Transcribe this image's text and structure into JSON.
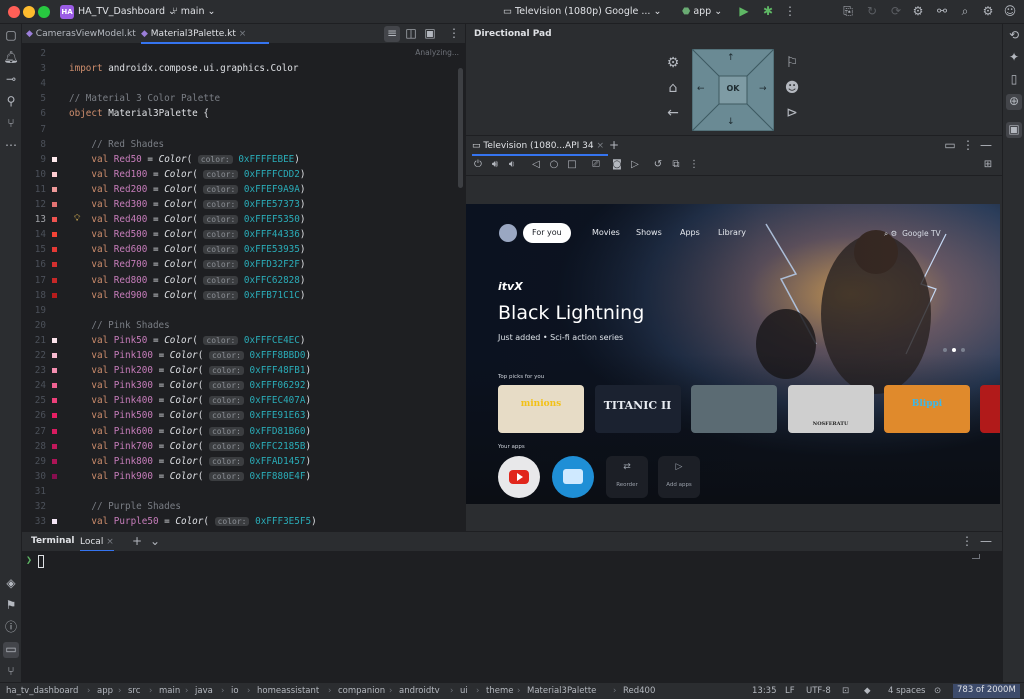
{
  "window": {
    "project": "HA_TV_Dashboard",
    "branch": "main",
    "device": "Television (1080p) Google ...",
    "run_config": "app"
  },
  "editor": {
    "tabs": [
      {
        "label": "CamerasViewModel.kt"
      },
      {
        "label": "Material3Palette.kt"
      }
    ],
    "analyzing": "Analyzing...",
    "lines": [
      {
        "n": "2",
        "html": ""
      },
      {
        "n": "3",
        "html": "<span class='kw'>import</span> androidx.compose.ui.graphics.Color"
      },
      {
        "n": "4",
        "html": ""
      },
      {
        "n": "5",
        "html": "<span class='cm'>// Material 3 Color Palette</span>"
      },
      {
        "n": "6",
        "html": "<span class='kw'>object</span> Material3Palette {"
      },
      {
        "n": "7",
        "html": ""
      },
      {
        "n": "8",
        "html": "    <span class='cm'>// Red Shades</span>"
      },
      {
        "n": "9",
        "sw": "#ffebee",
        "html": "    <span class='kw'>val</span> <span class='pr'>Red50</span> = <span class='fn'>Color</span>( <span class='hint'>color:</span> <span class='hx'>0xFFFFEBEE</span>)"
      },
      {
        "n": "10",
        "sw": "#ffcdd2",
        "html": "    <span class='kw'>val</span> <span class='pr'>Red100</span> = <span class='fn'>Color</span>( <span class='hint'>color:</span> <span class='hx'>0xFFFFCDD2</span>)"
      },
      {
        "n": "11",
        "sw": "#ef9a9a",
        "html": "    <span class='kw'>val</span> <span class='pr'>Red200</span> = <span class='fn'>Color</span>( <span class='hint'>color:</span> <span class='hx'>0xFFEF9A9A</span>)"
      },
      {
        "n": "12",
        "sw": "#e57373",
        "html": "    <span class='kw'>val</span> <span class='pr'>Red300</span> = <span class='fn'>Color</span>( <span class='hint'>color:</span> <span class='hx'>0xFFE57373</span>)"
      },
      {
        "n": "13",
        "sw": "#ef5350",
        "bulb": true,
        "html": "    <span class='kw'>val</span> <span class='pr'>Red400</span> = <span class='fn'>Color</span>( <span class='hint'>color:</span> <span class='hx'>0xFFEF5350</span>)"
      },
      {
        "n": "14",
        "sw": "#f44336",
        "html": "    <span class='kw'>val</span> <span class='pr'>Red500</span> = <span class='fn'>Color</span>( <span class='hint'>color:</span> <span class='hx'>0xFFF44336</span>)"
      },
      {
        "n": "15",
        "sw": "#e53935",
        "html": "    <span class='kw'>val</span> <span class='pr'>Red600</span> = <span class='fn'>Color</span>( <span class='hint'>color:</span> <span class='hx'>0xFFE53935</span>)"
      },
      {
        "n": "16",
        "sw": "#d32f2f",
        "html": "    <span class='kw'>val</span> <span class='pr'>Red700</span> = <span class='fn'>Color</span>( <span class='hint'>color:</span> <span class='hx'>0xFFD32F2F</span>)"
      },
      {
        "n": "17",
        "sw": "#c62828",
        "html": "    <span class='kw'>val</span> <span class='pr'>Red800</span> = <span class='fn'>Color</span>( <span class='hint'>color:</span> <span class='hx'>0xFFC62828</span>)"
      },
      {
        "n": "18",
        "sw": "#b71c1c",
        "html": "    <span class='kw'>val</span> <span class='pr'>Red900</span> = <span class='fn'>Color</span>( <span class='hint'>color:</span> <span class='hx'>0xFFB71C1C</span>)"
      },
      {
        "n": "19",
        "html": ""
      },
      {
        "n": "20",
        "html": "    <span class='cm'>// Pink Shades</span>"
      },
      {
        "n": "21",
        "sw": "#fce4ec",
        "html": "    <span class='kw'>val</span> <span class='pr'>Pink50</span> = <span class='fn'>Color</span>( <span class='hint'>color:</span> <span class='hx'>0xFFFCE4EC</span>)"
      },
      {
        "n": "22",
        "sw": "#f8bbd0",
        "html": "    <span class='kw'>val</span> <span class='pr'>Pink100</span> = <span class='fn'>Color</span>( <span class='hint'>color:</span> <span class='hx'>0xFFF8BBD0</span>)"
      },
      {
        "n": "23",
        "sw": "#f48fb1",
        "html": "    <span class='kw'>val</span> <span class='pr'>Pink200</span> = <span class='fn'>Color</span>( <span class='hint'>color:</span> <span class='hx'>0xFFF48FB1</span>)"
      },
      {
        "n": "24",
        "sw": "#f06292",
        "html": "    <span class='kw'>val</span> <span class='pr'>Pink300</span> = <span class='fn'>Color</span>( <span class='hint'>color:</span> <span class='hx'>0xFFF06292</span>)"
      },
      {
        "n": "25",
        "sw": "#ec407a",
        "html": "    <span class='kw'>val</span> <span class='pr'>Pink400</span> = <span class='fn'>Color</span>( <span class='hint'>color:</span> <span class='hx'>0xFFEC407A</span>)"
      },
      {
        "n": "26",
        "sw": "#e91e63",
        "html": "    <span class='kw'>val</span> <span class='pr'>Pink500</span> = <span class='fn'>Color</span>( <span class='hint'>color:</span> <span class='hx'>0xFFE91E63</span>)"
      },
      {
        "n": "27",
        "sw": "#d81b60",
        "html": "    <span class='kw'>val</span> <span class='pr'>Pink600</span> = <span class='fn'>Color</span>( <span class='hint'>color:</span> <span class='hx'>0xFFD81B60</span>)"
      },
      {
        "n": "28",
        "sw": "#c2185b",
        "html": "    <span class='kw'>val</span> <span class='pr'>Pink700</span> = <span class='fn'>Color</span>( <span class='hint'>color:</span> <span class='hx'>0xFFC2185B</span>)"
      },
      {
        "n": "29",
        "sw": "#ad1457",
        "html": "    <span class='kw'>val</span> <span class='pr'>Pink800</span> = <span class='fn'>Color</span>( <span class='hint'>color:</span> <span class='hx'>0xFFAD1457</span>)"
      },
      {
        "n": "30",
        "sw": "#880e4f",
        "html": "    <span class='kw'>val</span> <span class='pr'>Pink900</span> = <span class='fn'>Color</span>( <span class='hint'>color:</span> <span class='hx'>0xFF880E4F</span>)"
      },
      {
        "n": "31",
        "html": ""
      },
      {
        "n": "32",
        "html": "    <span class='cm'>// Purple Shades</span>"
      },
      {
        "n": "33",
        "sw": "#f3e5f5",
        "html": "    <span class='kw'>val</span> <span class='pr'>Purple50</span> = <span class='fn'>Color</span>( <span class='hint'>color:</span> <span class='hx'>0xFFF3E5F5</span>)"
      }
    ]
  },
  "dpad": {
    "title": "Directional Pad",
    "ok": "OK",
    "up": "↑",
    "down": "↓",
    "left": "←",
    "right": "→"
  },
  "emulator": {
    "tab": "Television (1080...API 34"
  },
  "tv": {
    "nav": [
      "For you",
      "Movies",
      "Shows",
      "Apps",
      "Library"
    ],
    "brand": "Google TV",
    "provider": "itvX",
    "hero_title": "Black Lightning",
    "hero_sub": "Just added • Sci-fi action series",
    "top_picks_label": "Top picks for you",
    "cards": [
      "minions",
      "TITANIC II",
      "",
      "NOSFERATU",
      "Blippi"
    ],
    "your_apps_label": "Your apps",
    "reorder": "Reorder",
    "add_apps": "Add apps"
  },
  "terminal": {
    "title": "Terminal",
    "tab": "Local",
    "prompt": "❯"
  },
  "status": {
    "crumbs": [
      "ha_tv_dashboard",
      "app",
      "src",
      "main",
      "java",
      "io",
      "homeassistant",
      "companion",
      "androidtv",
      "ui",
      "theme",
      "Material3Palette",
      "Red400"
    ],
    "position": "13:35",
    "line_sep": "LF",
    "encoding": "UTF-8",
    "indent": "4 spaces",
    "memory": "783 of 2000M"
  },
  "colors": {
    "accent": "#3574f0",
    "tile": "#5d7f8a"
  }
}
